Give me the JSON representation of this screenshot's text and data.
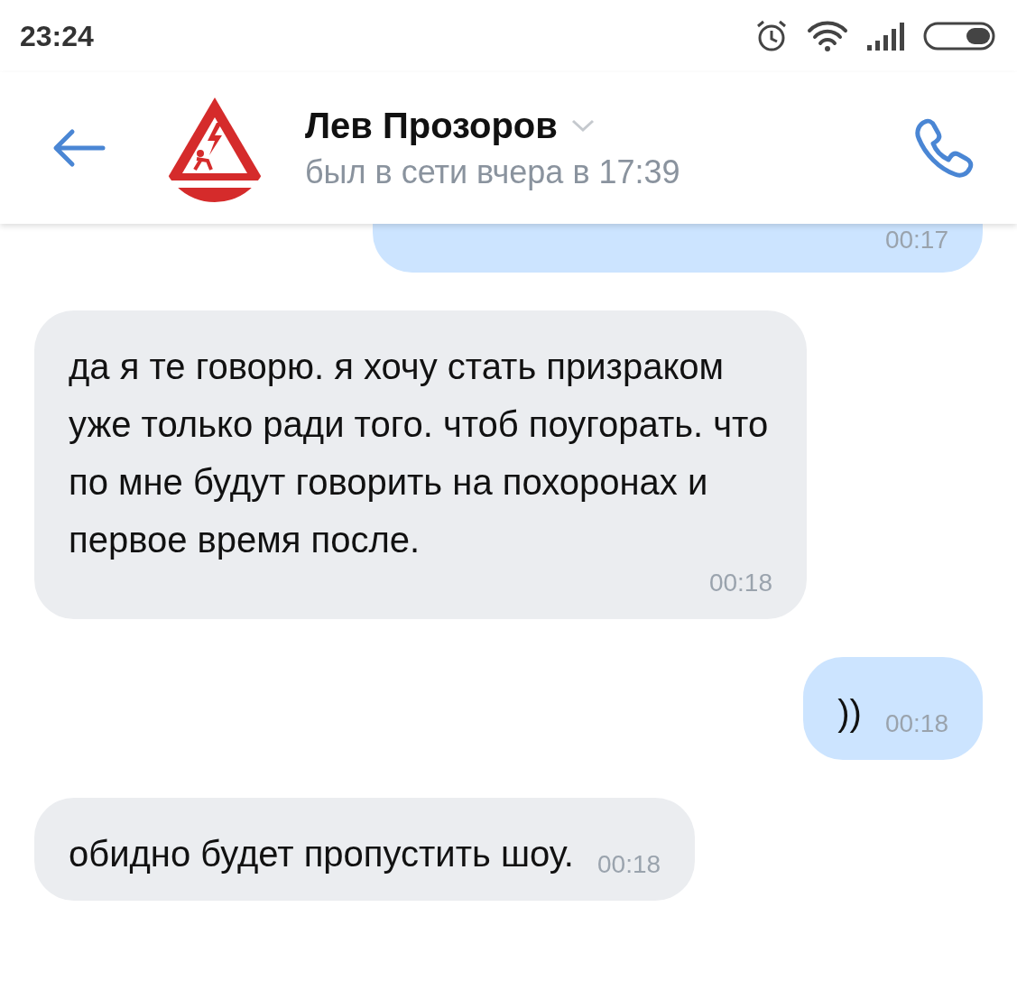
{
  "status_bar": {
    "time": "23:24"
  },
  "header": {
    "name": "Лев Прозоров",
    "status": "был в сети вчера в 17:39"
  },
  "messages": [
    {
      "kind": "outgoing",
      "time": "00:17"
    },
    {
      "kind": "incoming",
      "text": "да я те говорю. я хочу стать призраком уже только ради того. чтоб поугорать. что по мне будут говорить на похоронах и первое время после.",
      "time": "00:18"
    },
    {
      "kind": "outgoing",
      "text": "))",
      "time": "00:18"
    },
    {
      "kind": "incoming",
      "text": "обидно будет пропустить шоу.",
      "time": "00:18"
    }
  ]
}
